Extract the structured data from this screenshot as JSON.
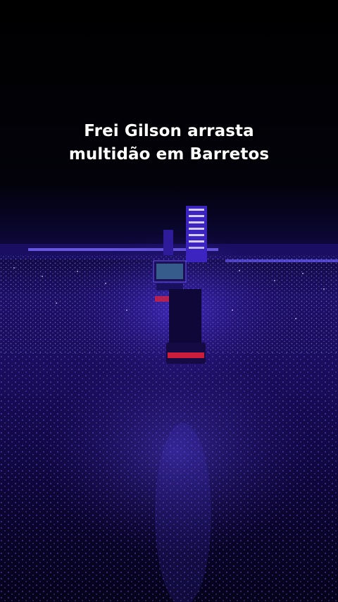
{
  "video": {
    "caption_line_1": "Frei Gilson arrasta",
    "caption_line_2": "multidão em Barretos"
  },
  "colors": {
    "background": "#000000",
    "crowd_light": "#3a24c8",
    "stage_light": "#7a63ff",
    "stage_red": "#e0203a"
  },
  "scene": {
    "description_icon": "concert-crowd-photo"
  }
}
